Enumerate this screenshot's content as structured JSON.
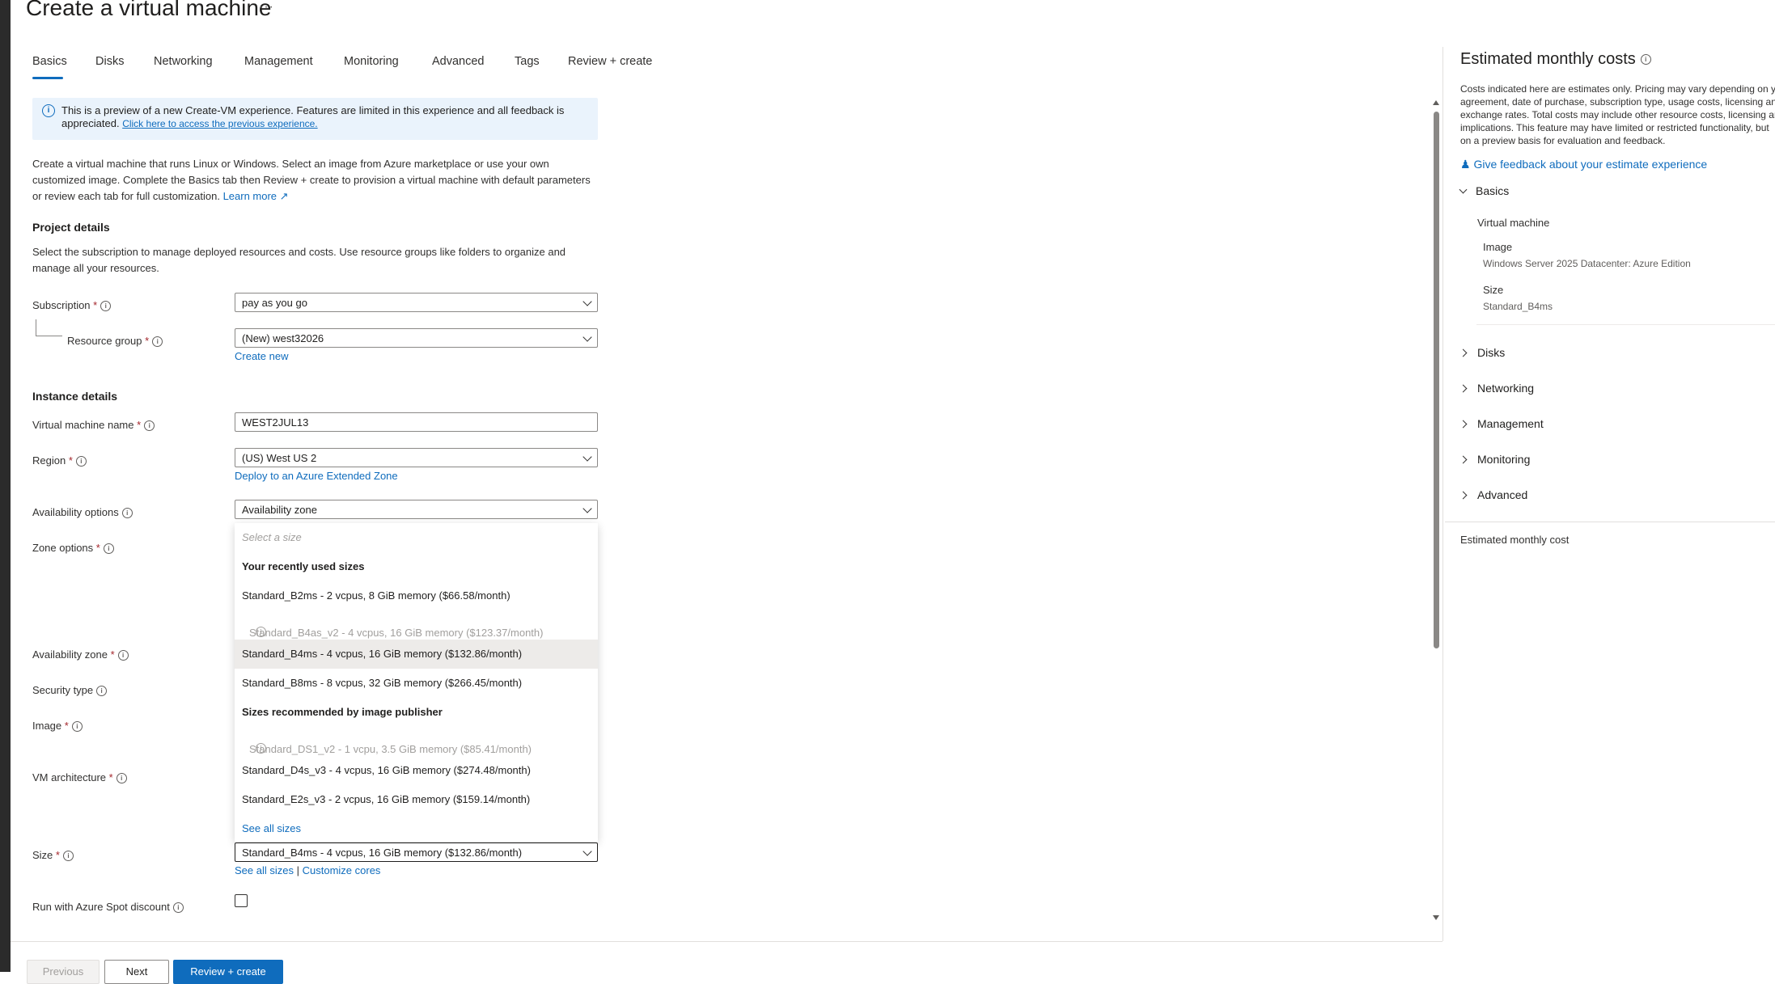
{
  "page": {
    "title": "Create a virtual machine",
    "more": "···"
  },
  "tabs": [
    "Basics",
    "Disks",
    "Networking",
    "Management",
    "Monitoring",
    "Advanced",
    "Tags",
    "Review + create"
  ],
  "banner": {
    "text": "This is a preview of a new Create-VM experience. Features are limited in this experience and all feedback is appreciated.",
    "link": "Click here to access the previous experience."
  },
  "intro": {
    "text": "Create a virtual machine that runs Linux or Windows. Select an image from Azure marketplace or use your own customized image. Complete the Basics tab then Review + create to provision a virtual machine with default parameters or review each tab for full customization.",
    "learn_more": "Learn more"
  },
  "project": {
    "heading": "Project details",
    "desc": "Select the subscription to manage deployed resources and costs. Use resource groups like folders to organize and manage all your resources.",
    "subscription_label": "Subscription",
    "subscription_value": "pay as you go",
    "rg_label": "Resource group",
    "rg_value": "(New) west32026",
    "create_new": "Create new"
  },
  "instance": {
    "heading": "Instance details",
    "vm_name_label": "Virtual machine name",
    "vm_name_value": "WEST2JUL13",
    "region_label": "Region",
    "region_value": "(US) West US 2",
    "extended_zone_link": "Deploy to an Azure Extended Zone",
    "availability_label": "Availability options",
    "availability_value": "Availability zone",
    "zone_options_label": "Zone options",
    "availability_zone_label": "Availability zone",
    "security_type_label": "Security type",
    "image_label": "Image",
    "vm_arch_label": "VM architecture",
    "size_label": "Size",
    "size_value": "Standard_B4ms - 4 vcpus, 16 GiB memory ($132.86/month)",
    "see_all_sizes": "See all sizes",
    "separator": "|",
    "customize_cores": "Customize cores",
    "spot_label": "Run with Azure Spot discount"
  },
  "size_dropdown": {
    "placeholder": "Select a size",
    "recent_heading": "Your recently used sizes",
    "recent": [
      "Standard_B2ms  -  2 vcpus, 8 GiB memory ($66.58/month)",
      "Standard_B4as_v2  -  4 vcpus, 16 GiB memory ($123.37/month)",
      "Standard_B4ms  -  4 vcpus, 16 GiB memory ($132.86/month)",
      "Standard_B8ms  -  8 vcpus, 32 GiB memory ($266.45/month)"
    ],
    "publisher_heading": "Sizes recommended by image publisher",
    "publisher": [
      "Standard_DS1_v2  -  1 vcpu, 3.5 GiB memory ($85.41/month)",
      "Standard_D4s_v3  -  4 vcpus, 16 GiB memory ($274.48/month)",
      "Standard_E2s_v3  -  2 vcpus, 16 GiB memory ($159.14/month)"
    ],
    "see_all": "See all sizes",
    "selected_index": 2
  },
  "footer": {
    "previous": "Previous",
    "next": "Next",
    "review": "Review + create"
  },
  "costs": {
    "title": "Estimated monthly costs",
    "note_lines": [
      "Costs indicated here are estimates only. Pricing may vary depending on your",
      "agreement, date of purchase, subscription type, usage costs, licensing and",
      "exchange rates. Total costs may include other resource costs, licensing and",
      "implications. This feature may have limited or restricted functionality, but",
      "on a preview basis for evaluation and feedback."
    ],
    "feedback": "Give feedback about your estimate experience",
    "basics": "Basics",
    "vm": "Virtual machine",
    "image_label": "Image",
    "image_value": "Windows Server 2025 Datacenter: Azure Edition",
    "size_label": "Size",
    "size_value": "Standard_B4ms",
    "sections": [
      "Disks",
      "Networking",
      "Management",
      "Monitoring",
      "Advanced"
    ],
    "estimated_cost": "Estimated monthly cost"
  },
  "colors": {
    "accent": "#0f6cbd",
    "required": "#a4262c",
    "selected_bg": "#edebe9",
    "banner_bg": "#eaf3fc"
  }
}
